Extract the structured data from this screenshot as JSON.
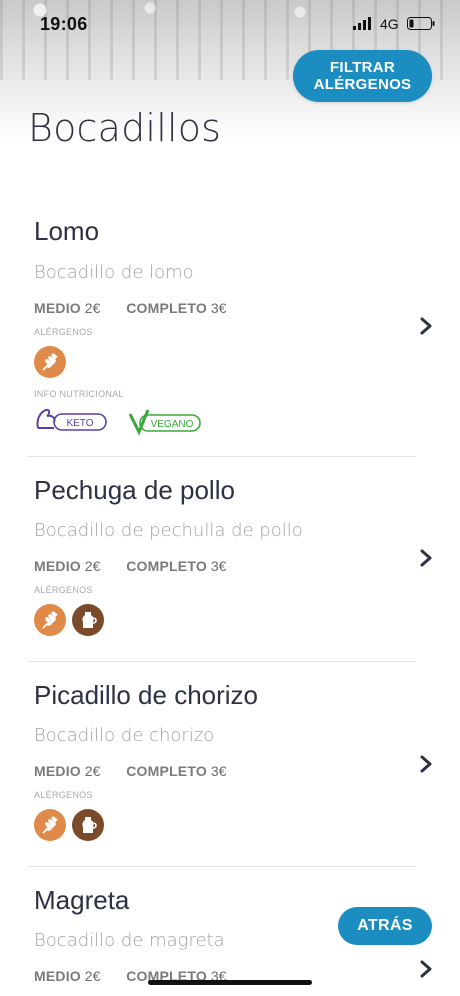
{
  "status_bar": {
    "time": "19:06",
    "network": "4G"
  },
  "header": {
    "filter_button_line1": "FILTRAR",
    "filter_button_line2": "ALÉRGENOS",
    "title": "Bocadillos"
  },
  "labels": {
    "allergens": "ALÉRGENOS",
    "nutrition": "INFO NUTRICIONAL"
  },
  "items": [
    {
      "name": "Lomo",
      "description": "Bocadillo de lomo",
      "prices": [
        {
          "label": "MEDIO",
          "value": "2€"
        },
        {
          "label": "COMPLETO",
          "value": "3€"
        }
      ],
      "allergens": [
        "gluten-icon"
      ],
      "nutrition": [
        {
          "label": "KETO",
          "icon": "keto-muscle-icon",
          "color": "#5b3fa8"
        },
        {
          "label": "VEGANO",
          "icon": "vegan-v-icon",
          "color": "#3aa83a"
        }
      ]
    },
    {
      "name": "Pechuga de pollo",
      "description": "Bocadillo de pechulla de pollo",
      "prices": [
        {
          "label": "MEDIO",
          "value": "2€"
        },
        {
          "label": "COMPLETO",
          "value": "3€"
        }
      ],
      "allergens": [
        "gluten-icon",
        "lactose-icon"
      ]
    },
    {
      "name": "Picadillo de chorizo",
      "description": "Bocadillo de chorizo",
      "prices": [
        {
          "label": "MEDIO",
          "value": "2€"
        },
        {
          "label": "COMPLETO",
          "value": "3€"
        }
      ],
      "allergens": [
        "gluten-icon",
        "lactose-icon"
      ]
    },
    {
      "name": "Magreta",
      "description": "Bocadillo de magreta",
      "prices": [
        {
          "label": "MEDIO",
          "value": "2€"
        },
        {
          "label": "COMPLETO",
          "value": "3€"
        }
      ]
    }
  ],
  "footer": {
    "back_button": "ATRÁS"
  },
  "colors": {
    "accent": "#1c8dc0",
    "gluten": "#e08a4a",
    "lactose": "#7a4a2a",
    "keto": "#5b3fa8",
    "vegan": "#3aa83a"
  }
}
